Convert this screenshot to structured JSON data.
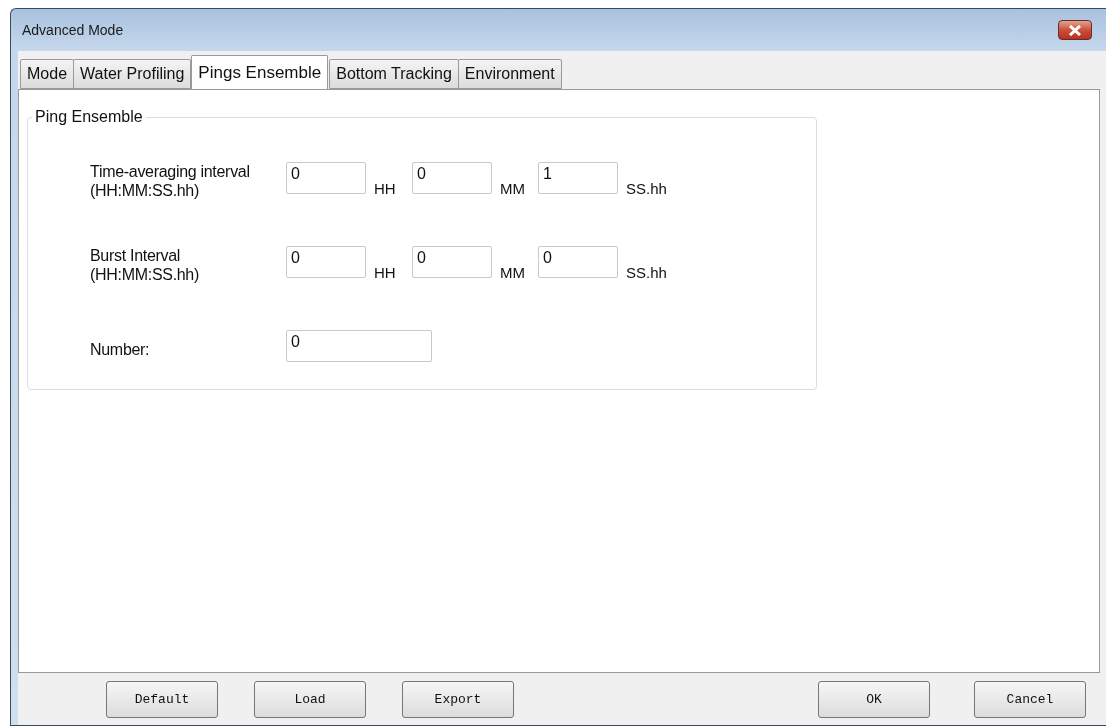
{
  "window": {
    "title": "Advanced Mode"
  },
  "tabs": [
    {
      "label": "Mode",
      "selected": false
    },
    {
      "label": "Water Profiling",
      "selected": false
    },
    {
      "label": "Pings Ensemble",
      "selected": true
    },
    {
      "label": "Bottom Tracking",
      "selected": false
    },
    {
      "label": "Environment",
      "selected": false
    }
  ],
  "group": {
    "title": "Ping Ensemble",
    "rows": [
      {
        "kind": "interval",
        "label": [
          "Time-averaging interval",
          "(HH:MM:SS.hh)"
        ],
        "fields": [
          {
            "value": "0",
            "unit": "HH"
          },
          {
            "value": "0",
            "unit": "MM"
          },
          {
            "value": "1",
            "unit": "SS.hh"
          }
        ]
      },
      {
        "kind": "interval",
        "label": [
          "Burst Interval",
          "(HH:MM:SS.hh)"
        ],
        "fields": [
          {
            "value": "0",
            "unit": "HH"
          },
          {
            "value": "0",
            "unit": "MM"
          },
          {
            "value": "0",
            "unit": "SS.hh"
          }
        ]
      },
      {
        "kind": "single",
        "label": [
          "Number:"
        ],
        "fields": [
          {
            "value": "0"
          }
        ]
      }
    ]
  },
  "buttons_left": [
    "Default",
    "Load",
    "Export"
  ],
  "buttons_right": [
    "OK",
    "Cancel"
  ]
}
